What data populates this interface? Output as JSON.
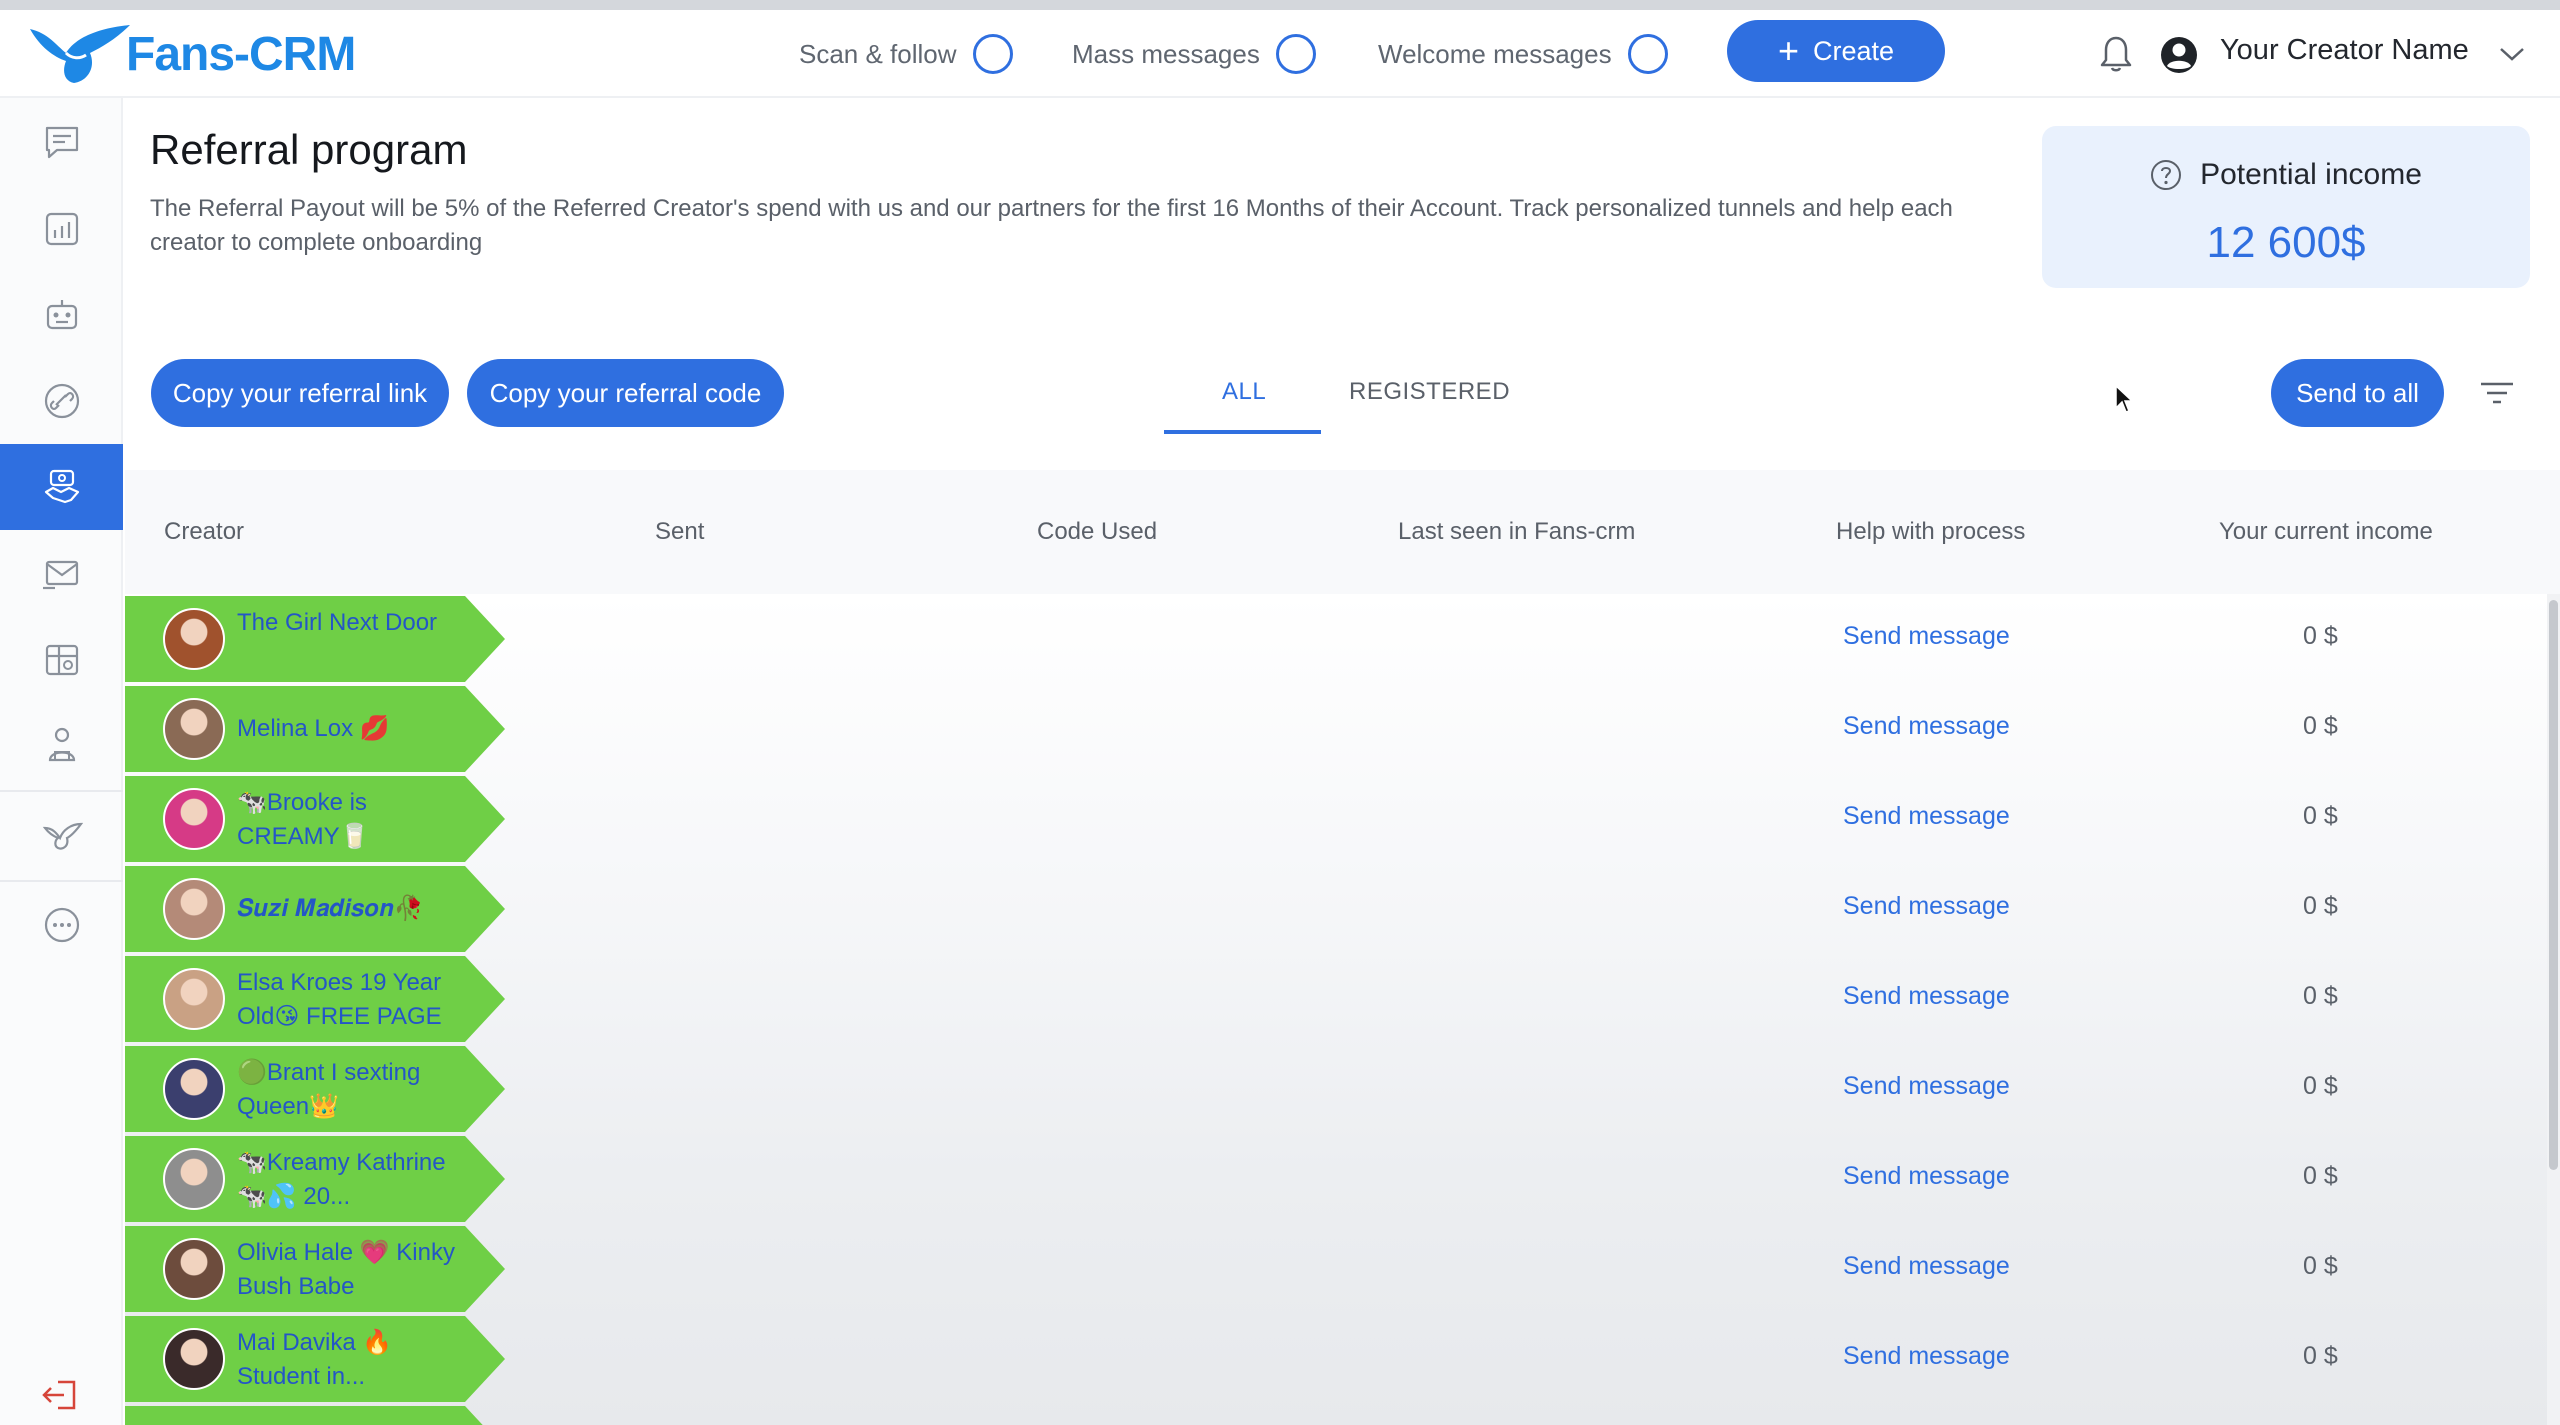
{
  "app": {
    "name": "Fans-CRM",
    "brand_color": "#2f6fe0",
    "row_green": "#6fcf46"
  },
  "topbar": {
    "toggles": [
      {
        "label": "Scan & follow",
        "icon": "toggle-ring-icon"
      },
      {
        "label": "Mass messages",
        "icon": "toggle-ring-icon"
      },
      {
        "label": "Welcome messages",
        "icon": "toggle-ring-icon"
      }
    ],
    "create_label": "Create",
    "user_name": "Your Creator Name",
    "icons": [
      "bell-icon",
      "user-account-icon",
      "chevron-down-icon"
    ]
  },
  "sidebar": {
    "items": [
      {
        "icon": "chat-icon"
      },
      {
        "icon": "analytics-icon"
      },
      {
        "icon": "bot-icon"
      },
      {
        "icon": "tracking-link-icon"
      },
      {
        "icon": "referral-handshake-icon",
        "active": true
      },
      {
        "icon": "mass-mail-icon"
      },
      {
        "icon": "vault-icon"
      },
      {
        "icon": "agency-team-icon"
      },
      {
        "icon": "wing-logo-icon"
      },
      {
        "icon": "more-icon"
      }
    ],
    "logout_icon": "logout-icon"
  },
  "page": {
    "title": "Referral program",
    "description": "The Referral Payout will be 5% of the Referred Creator's spend with us and our partners for the first 16 Months of their Account. Track personalized tunnels and help each creator to complete onboarding"
  },
  "income_card": {
    "label": "Potential income",
    "value": "12 600$"
  },
  "actions": {
    "copy_link": "Copy your referral link",
    "copy_code": "Copy your referral code",
    "send_all": "Send to all"
  },
  "tabs": [
    {
      "label": "ALL",
      "active": true
    },
    {
      "label": "REGISTERED",
      "active": false
    }
  ],
  "table": {
    "columns": [
      "Creator",
      "Sent",
      "Code Used",
      "Last seen in Fans-crm",
      "Help with process",
      "Your current income"
    ],
    "rows": [
      {
        "name": "The Girl Next Door",
        "action": "Send message",
        "income": "0 $",
        "avatar_color": "#a0522d"
      },
      {
        "name": "Melina Lox 💋",
        "action": "Send message",
        "income": "0 $",
        "avatar_color": "#8a6a55"
      },
      {
        "name": "🐄Brooke is CREAMY🥛",
        "action": "Send message",
        "income": "0 $",
        "avatar_color": "#d63a86"
      },
      {
        "name": "𝑺𝒖𝒛𝒊 𝑴𝒂𝒅𝒊𝒔𝒐𝒏🥀",
        "action": "Send message",
        "income": "0 $",
        "avatar_color": "#b48a78"
      },
      {
        "name": "Elsa Kroes 19 Year Old😘 FREE PAGE",
        "action": "Send message",
        "income": "0 $",
        "avatar_color": "#c9a184"
      },
      {
        "name": "🟢Brant I sexting Queen👑",
        "action": "Send message",
        "income": "0 $",
        "avatar_color": "#3b3f6e"
      },
      {
        "name": "🐄Kreamy Kathrine🐄💦 20...",
        "action": "Send message",
        "income": "0 $",
        "avatar_color": "#8e8e8e"
      },
      {
        "name": "Olivia Hale 💗 Kinky Bush Babe",
        "action": "Send message",
        "income": "0 $",
        "avatar_color": "#6d4c3d"
      },
      {
        "name": "Mai Davika 🔥 Student in...",
        "action": "Send message",
        "income": "0 $",
        "avatar_color": "#3a2a2a"
      }
    ]
  }
}
